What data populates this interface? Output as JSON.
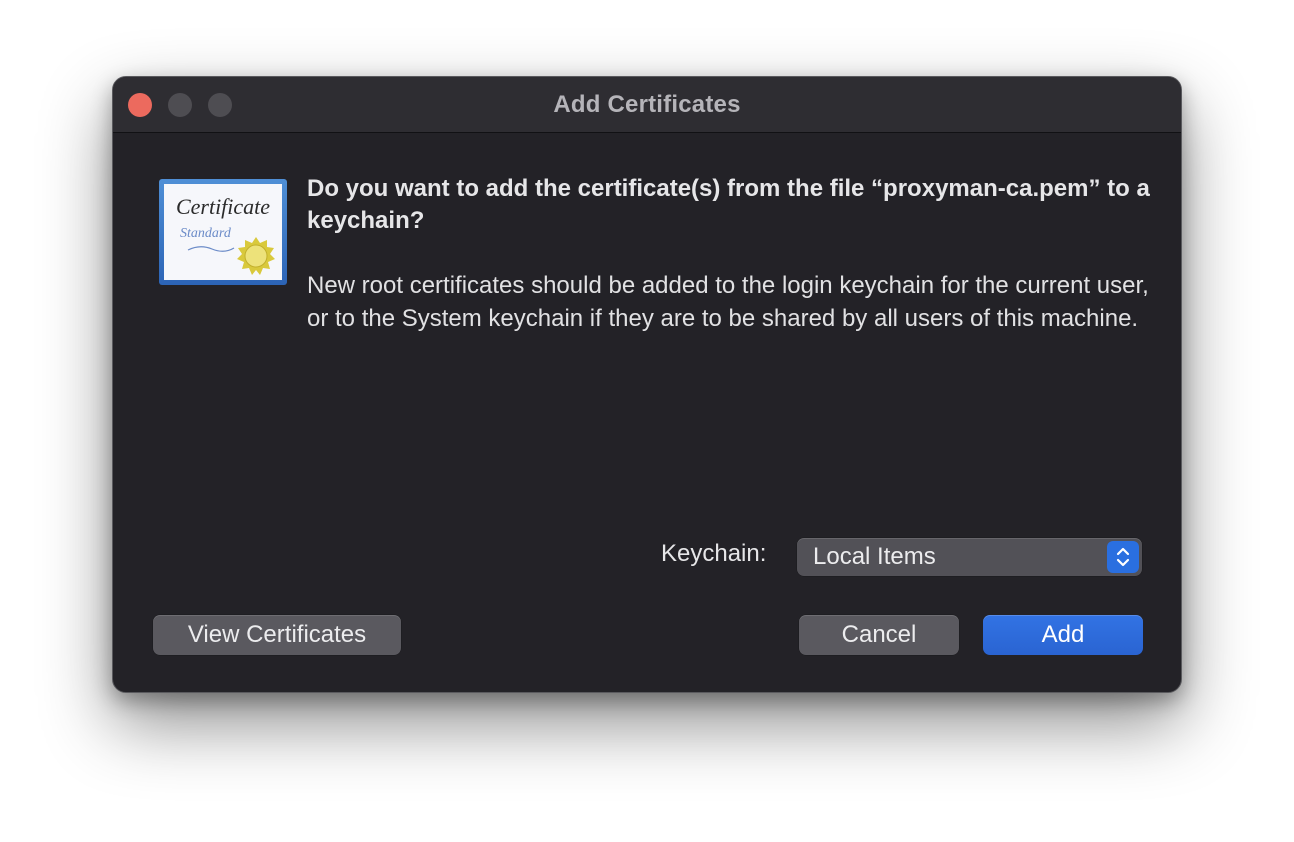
{
  "window": {
    "title": "Add Certificates"
  },
  "icon": {
    "name": "certificate-icon",
    "word": "Certificate",
    "subtitle": "Standard"
  },
  "dialog": {
    "heading": "Do you want to add the certificate(s) from the file “proxyman-ca.pem” to a keychain?",
    "body": "New root certificates should be added to the login keychain for the current user, or to the System keychain if they are to be shared by all users of this machine."
  },
  "keychain": {
    "label": "Keychain:",
    "selected": "Local Items"
  },
  "buttons": {
    "view_certificates": "View Certificates",
    "cancel": "Cancel",
    "add": "Add"
  },
  "colors": {
    "window_bg": "#232227",
    "accent": "#2a6fe0",
    "close": "#ec6a5e"
  }
}
